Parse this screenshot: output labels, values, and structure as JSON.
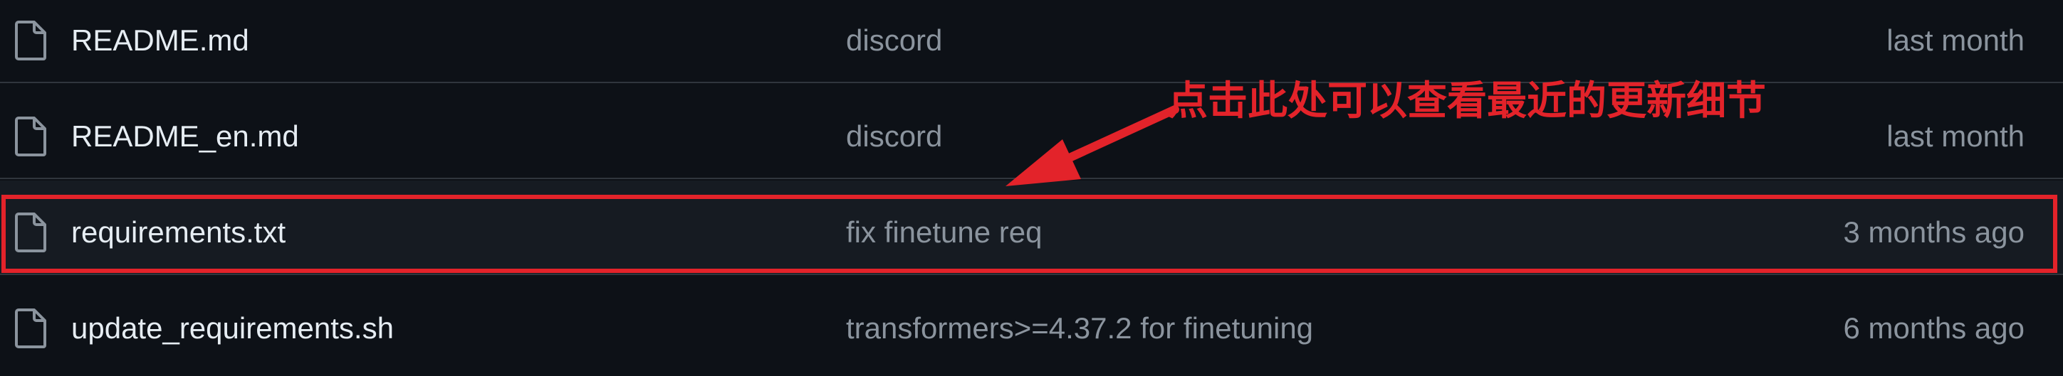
{
  "files": [
    {
      "icon": "file-icon",
      "name": "README.md",
      "commit_message": "discord",
      "date": "last month"
    },
    {
      "icon": "file-icon",
      "name": "README_en.md",
      "commit_message": "discord",
      "date": "last month"
    },
    {
      "icon": "file-icon",
      "name": "requirements.txt",
      "commit_message": "fix finetune req",
      "date": "3 months ago"
    },
    {
      "icon": "file-icon",
      "name": "update_requirements.sh",
      "commit_message": "transformers>=4.37.2 for finetuning",
      "date": "6 months ago"
    }
  ],
  "annotation": {
    "text": "点击此处可以查看最近的更新细节",
    "color": "#e3232a"
  },
  "colors": {
    "background": "#0d1117",
    "highlighted_row": "#161b22",
    "divider": "#30363d",
    "primary_text": "#e6edf3",
    "secondary_text": "#8b949e"
  }
}
